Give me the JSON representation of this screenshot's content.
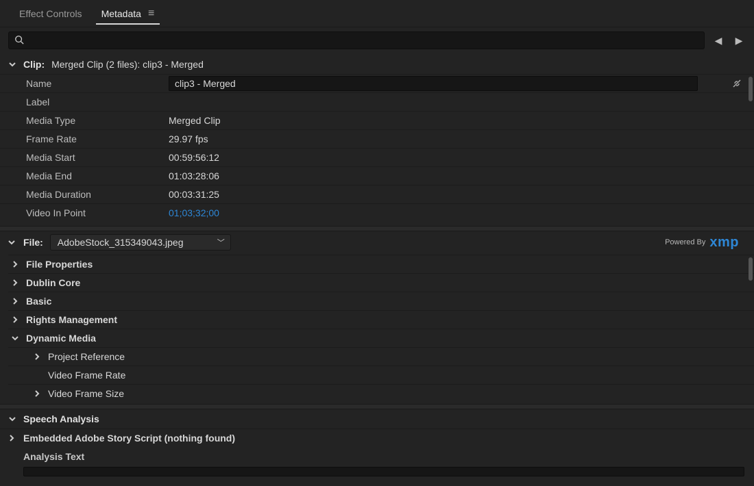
{
  "tabs": {
    "effect_controls": "Effect Controls",
    "metadata": "Metadata"
  },
  "search": {
    "placeholder": ""
  },
  "clip": {
    "header_label": "Clip:",
    "header_value": "Merged Clip (2 files): clip3 - Merged",
    "rows": {
      "name_label": "Name",
      "name_value": "clip3 - Merged",
      "label_label": "Label",
      "media_type_label": "Media Type",
      "media_type_value": "Merged Clip",
      "frame_rate_label": "Frame Rate",
      "frame_rate_value": "29.97 fps",
      "media_start_label": "Media Start",
      "media_start_value": "00:59:56:12",
      "media_end_label": "Media End",
      "media_end_value": "01:03:28:06",
      "media_duration_label": "Media Duration",
      "media_duration_value": "00:03:31:25",
      "video_in_label": "Video In Point",
      "video_in_value": "01;03;32;00"
    }
  },
  "file": {
    "header_label": "File:",
    "selected": "AdobeStock_315349043.jpeg",
    "powered_label": "Powered By",
    "xmp": "xmp",
    "groups": {
      "file_properties": "File Properties",
      "dublin_core": "Dublin Core",
      "basic": "Basic",
      "rights_mgmt": "Rights Management",
      "dynamic_media": "Dynamic Media",
      "project_reference": "Project Reference",
      "video_frame_rate": "Video Frame Rate",
      "video_frame_size": "Video Frame Size"
    }
  },
  "speech": {
    "header": "Speech Analysis",
    "embedded": "Embedded Adobe Story Script (nothing found)",
    "analysis_text": "Analysis Text"
  }
}
